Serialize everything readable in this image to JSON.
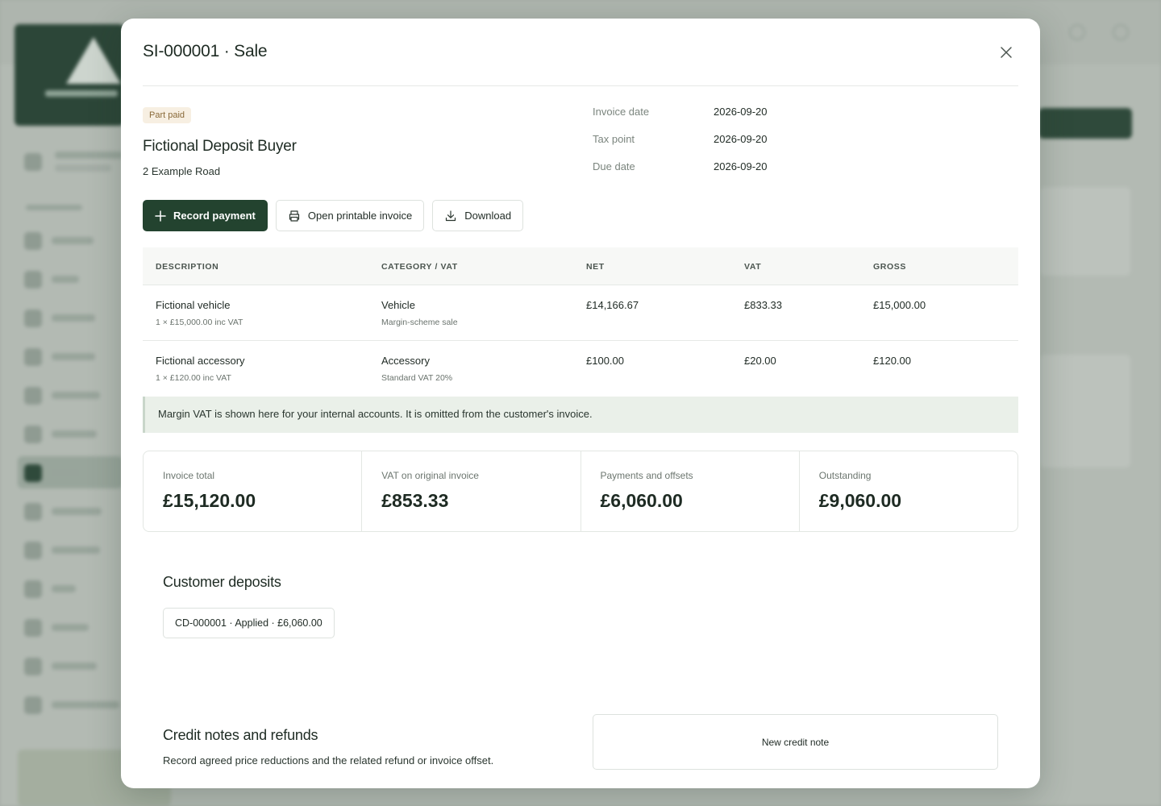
{
  "modal": {
    "title": "SI-000001 · Sale",
    "status_badge": "Part paid",
    "customer": {
      "name": "Fictional Deposit Buyer",
      "address": "2 Example Road"
    },
    "dates": [
      {
        "label": "Invoice date",
        "value": "2026-09-20"
      },
      {
        "label": "Tax point",
        "value": "2026-09-20"
      },
      {
        "label": "Due date",
        "value": "2026-09-20"
      }
    ],
    "actions": {
      "record_payment": "Record payment",
      "open_printable": "Open printable invoice",
      "download": "Download"
    },
    "table": {
      "headers": [
        "DESCRIPTION",
        "CATEGORY / VAT",
        "NET",
        "VAT",
        "GROSS"
      ],
      "rows": [
        {
          "description": "Fictional vehicle",
          "description_sub": "1 × £15,000.00 inc VAT",
          "category": "Vehicle",
          "category_sub": "Margin-scheme sale",
          "net": "£14,166.67",
          "vat": "£833.33",
          "gross": "£15,000.00"
        },
        {
          "description": "Fictional accessory",
          "description_sub": "1 × £120.00 inc VAT",
          "category": "Accessory",
          "category_sub": "Standard VAT 20%",
          "net": "£100.00",
          "vat": "£20.00",
          "gross": "£120.00"
        }
      ]
    },
    "notice": "Margin VAT is shown here for your internal accounts. It is omitted from the customer's invoice.",
    "summary": [
      {
        "label": "Invoice total",
        "value": "£15,120.00"
      },
      {
        "label": "VAT on original invoice",
        "value": "£853.33"
      },
      {
        "label": "Payments and offsets",
        "value": "£6,060.00"
      },
      {
        "label": "Outstanding",
        "value": "£9,060.00"
      }
    ],
    "deposits": {
      "title": "Customer deposits",
      "chip": "CD-000001 · Applied · £6,060.00"
    },
    "credit_notes": {
      "title": "Credit notes and refunds",
      "description": "Record agreed price reductions and the related refund or invoice offset.",
      "new_button": "New credit note"
    }
  },
  "colors": {
    "primary": "#23432f",
    "badge_bg": "#f7efe2",
    "badge_text": "#8a6a3a",
    "notice_bg": "#eaf0e9",
    "overlay": "#a5ada6"
  },
  "icons": {
    "close": "close-icon",
    "plus": "plus-icon",
    "printer": "printer-icon",
    "download": "download-icon"
  }
}
